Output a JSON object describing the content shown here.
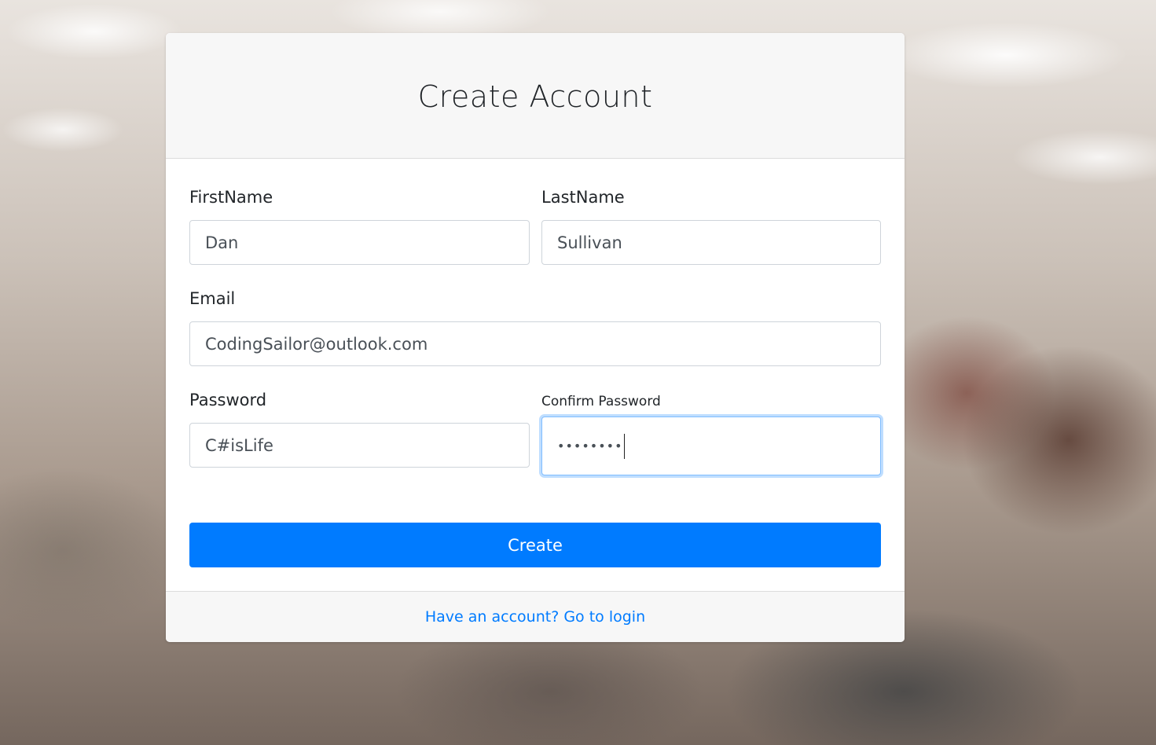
{
  "card": {
    "title": "Create Account"
  },
  "form": {
    "first_name": {
      "label": "FirstName",
      "value": "Dan"
    },
    "last_name": {
      "label": "LastName",
      "value": "Sullivan"
    },
    "email": {
      "label": "Email",
      "value": "CodingSailor@outlook.com"
    },
    "password": {
      "label": "Password",
      "value": "C#isLife"
    },
    "confirm_password": {
      "label": "Confirm Password",
      "value": "••••••••"
    },
    "submit_label": "Create"
  },
  "footer": {
    "login_link": "Have an account? Go to login"
  },
  "colors": {
    "accent": "#007bff",
    "header_bg": "#f7f7f7",
    "focus_ring": "#80bdff"
  }
}
